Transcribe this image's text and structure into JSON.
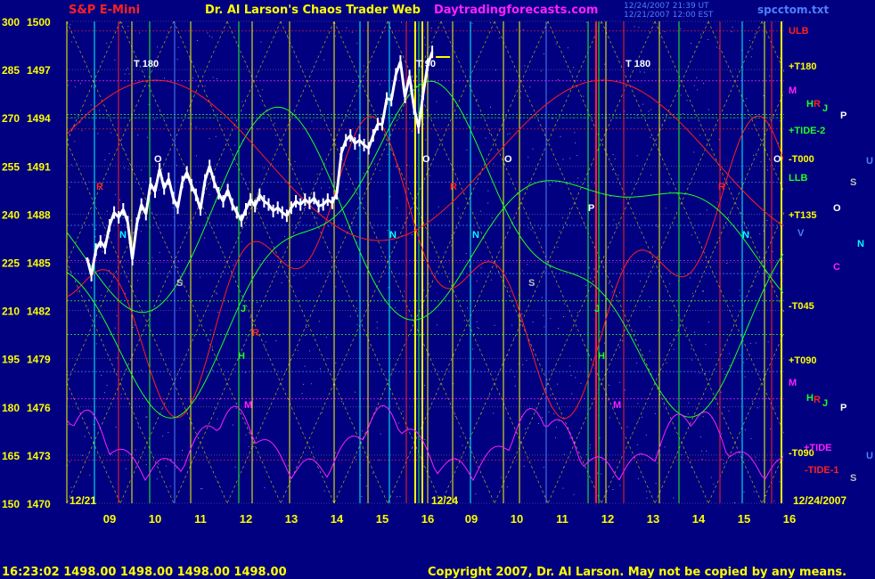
{
  "header": {
    "symbol": "S&P E-Mini",
    "title": "Dr. Al Larson's Chaos Trader Web",
    "site": "Daytradingforecasts.com",
    "file": "spcctom.txt",
    "stamp_line1": "12/24/2007 21:39 UT",
    "stamp_line2": "12/21/2007 12:00 EST"
  },
  "footer": {
    "status": "16:23:02  1498.00  1498.00  1498.00  1498.00",
    "copyright": "Copyright 2007, Dr. Al Larson. May not be copied by any means."
  },
  "colors": {
    "background": "#000080",
    "price": "#ffffff",
    "red": "#ff2020",
    "green": "#20ff20",
    "yellow": "#ffff00",
    "magenta": "#ff20ff",
    "cyan": "#00ffff",
    "grid": "#c8c800"
  },
  "chart_data": {
    "type": "line",
    "y_left_index": [
      300,
      285,
      270,
      255,
      240,
      225,
      210,
      195,
      180,
      165,
      150
    ],
    "y_price": [
      1500,
      1497,
      1494,
      1491,
      1488,
      1485,
      1482,
      1479,
      1476,
      1473,
      1470
    ],
    "ylim": [
      1470,
      1500
    ],
    "x_ticks": [
      "09",
      "10",
      "11",
      "12",
      "13",
      "14",
      "15",
      "16",
      "09",
      "10",
      "11",
      "12",
      "13",
      "14",
      "15",
      "16"
    ],
    "date_labels": [
      "12/21",
      "12/24",
      "12/24/2007"
    ],
    "x_hour_range": [
      8.5,
      24
    ],
    "price": {
      "name": "Price",
      "x": [
        8.5,
        8.6,
        8.7,
        8.8,
        8.9,
        9.0,
        9.1,
        9.2,
        9.3,
        9.4,
        9.5,
        9.6,
        9.7,
        9.8,
        9.9,
        10.0,
        10.1,
        10.2,
        10.3,
        10.4,
        10.5,
        10.6,
        10.7,
        10.8,
        10.9,
        11.0,
        11.1,
        11.2,
        11.3,
        11.4,
        11.5,
        11.6,
        11.7,
        11.8,
        11.9,
        12.0,
        12.1,
        12.2,
        12.3,
        12.4,
        12.5,
        12.6,
        12.7,
        12.8,
        12.9,
        13.0,
        13.1,
        13.2,
        13.3,
        13.4,
        13.5,
        13.6,
        13.7,
        13.8,
        13.9,
        14.0,
        14.1,
        14.2,
        14.3,
        14.4,
        14.5,
        14.6,
        14.7,
        14.8,
        14.9,
        15.0,
        15.1,
        15.2,
        15.3,
        15.4,
        15.5,
        15.6,
        15.7,
        15.8,
        15.9,
        16.0,
        16.1
      ],
      "y": [
        1485.3,
        1484.2,
        1485.8,
        1486.3,
        1485.9,
        1487.3,
        1488.1,
        1487.8,
        1488.3,
        1487.5,
        1485.2,
        1487.4,
        1488.6,
        1488.0,
        1489.9,
        1489.4,
        1490.8,
        1489.6,
        1490.2,
        1489.0,
        1488.4,
        1490.0,
        1490.6,
        1489.8,
        1489.2,
        1488.3,
        1490.1,
        1491.0,
        1490.0,
        1489.3,
        1488.8,
        1489.5,
        1488.6,
        1488.1,
        1487.6,
        1488.3,
        1488.9,
        1488.5,
        1489.2,
        1488.8,
        1488.6,
        1488.2,
        1488.4,
        1488.1,
        1487.9,
        1488.4,
        1488.8,
        1488.6,
        1488.9,
        1488.7,
        1489.0,
        1488.5,
        1488.6,
        1488.9,
        1488.7,
        1489.3,
        1491.8,
        1492.6,
        1492.9,
        1492.4,
        1492.6,
        1492.3,
        1492.1,
        1492.9,
        1493.6,
        1493.6,
        1495.2,
        1495.1,
        1496.7,
        1497.5,
        1495.3,
        1496.6,
        1494.6,
        1493.4,
        1495.5,
        1497.3,
        1498.1
      ]
    },
    "vertical_marker_labels": [
      "R",
      "N",
      "S",
      "J",
      "H",
      "M",
      "R",
      "N",
      "R",
      "N",
      "P",
      "J",
      "H",
      "M",
      "R",
      "N",
      "S",
      "O",
      "O",
      "O",
      "O"
    ],
    "time_labels": [
      "T 180",
      "T 90",
      "T 180"
    ],
    "right_labels": [
      {
        "text": "ULB",
        "color": "#ff2020"
      },
      {
        "text": "+T180",
        "color": "#ffff00"
      },
      {
        "text": "M",
        "color": "#ff20ff"
      },
      {
        "text": "+TIDE-2",
        "color": "#20ff20"
      },
      {
        "text": "-T000",
        "color": "#ffff00"
      },
      {
        "text": "LLB",
        "color": "#20ff20"
      },
      {
        "text": "+T135",
        "color": "#ffff00"
      },
      {
        "text": "-T045",
        "color": "#ffff00"
      },
      {
        "text": "+T090",
        "color": "#ffff00"
      },
      {
        "text": "M",
        "color": "#ff20ff"
      },
      {
        "text": "-T090",
        "color": "#ffff00"
      },
      {
        "text": "+TIDE",
        "color": "#ff20ff"
      },
      {
        "text": "-TIDE-1",
        "color": "#ff2020"
      }
    ],
    "planet_labels": [
      {
        "text": "H",
        "color": "#20ff20"
      },
      {
        "text": "R",
        "color": "#ff2020"
      },
      {
        "text": "J",
        "color": "#20ff20"
      },
      {
        "text": "P",
        "color": "#ffffff"
      },
      {
        "text": "U",
        "color": "#4f7fff"
      },
      {
        "text": "S",
        "color": "#c0c0c0"
      },
      {
        "text": "O",
        "color": "#ffffff"
      },
      {
        "text": "V",
        "color": "#4f7fff"
      },
      {
        "text": "N",
        "color": "#00ffff"
      },
      {
        "text": "C",
        "color": "#ff20ff"
      },
      {
        "text": "H",
        "color": "#20ff20"
      },
      {
        "text": "R",
        "color": "#ff2020"
      },
      {
        "text": "J",
        "color": "#20ff20"
      },
      {
        "text": "P",
        "color": "#ffffff"
      },
      {
        "text": "U",
        "color": "#4f7fff"
      },
      {
        "text": "S",
        "color": "#c0c0c0"
      }
    ]
  }
}
